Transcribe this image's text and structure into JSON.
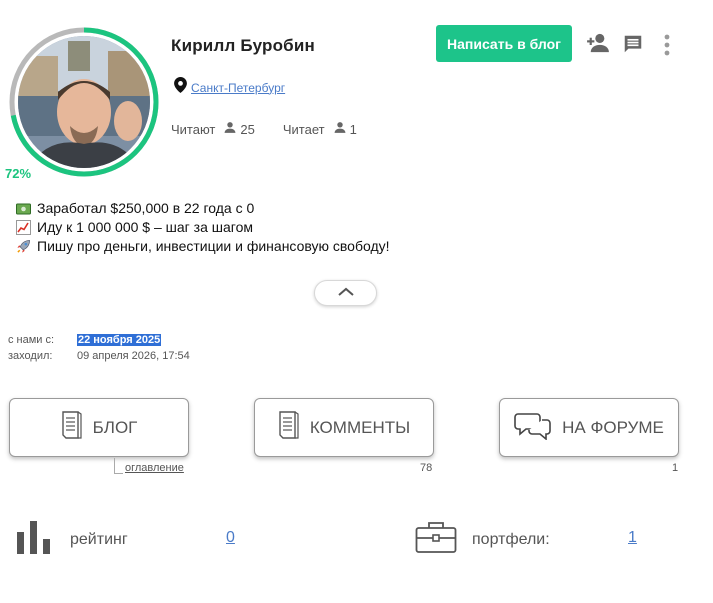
{
  "profile": {
    "name": "Кирилл Буробин",
    "location": "Санкт-Петербург",
    "completion": "72%",
    "followers_label": "Читают",
    "followers_count": "25",
    "following_label": "Читает",
    "following_count": "1"
  },
  "actions": {
    "write_blog": "Написать в блог",
    "icons": [
      "add-person-icon",
      "message-icon",
      "more-vert-icon"
    ]
  },
  "bio": {
    "lines": [
      {
        "icon": "dollar-banknote-icon",
        "text": "Заработал $250,000 в 22 года с 0"
      },
      {
        "icon": "chart-up-icon",
        "text": "Иду к 1 000 000 $ – шаг за шагом"
      },
      {
        "icon": "rocket-icon",
        "text": "Пишу про деньги, инвестиции и финансовую свободу!"
      }
    ]
  },
  "meta": {
    "joined_label": "с нами с:",
    "joined_value": "22 ноября 2025",
    "visited_label": "заходил:",
    "visited_value": "09 апреля 2026, 17:54"
  },
  "nav": {
    "blog": {
      "label": "БЛОГ",
      "sub": "оглавление"
    },
    "comments": {
      "label": "КОММЕНТЫ",
      "count": "78"
    },
    "forum": {
      "label": "НА ФОРУМЕ",
      "count": "1"
    }
  },
  "bottom": {
    "rating_label": "рейтинг",
    "rating_value": "0",
    "portfolio_label": "портфели:",
    "portfolio_value": "1"
  },
  "colors": {
    "accent": "#1dc48a",
    "link": "#4a7bc8",
    "highlight": "#2f6fd6"
  }
}
